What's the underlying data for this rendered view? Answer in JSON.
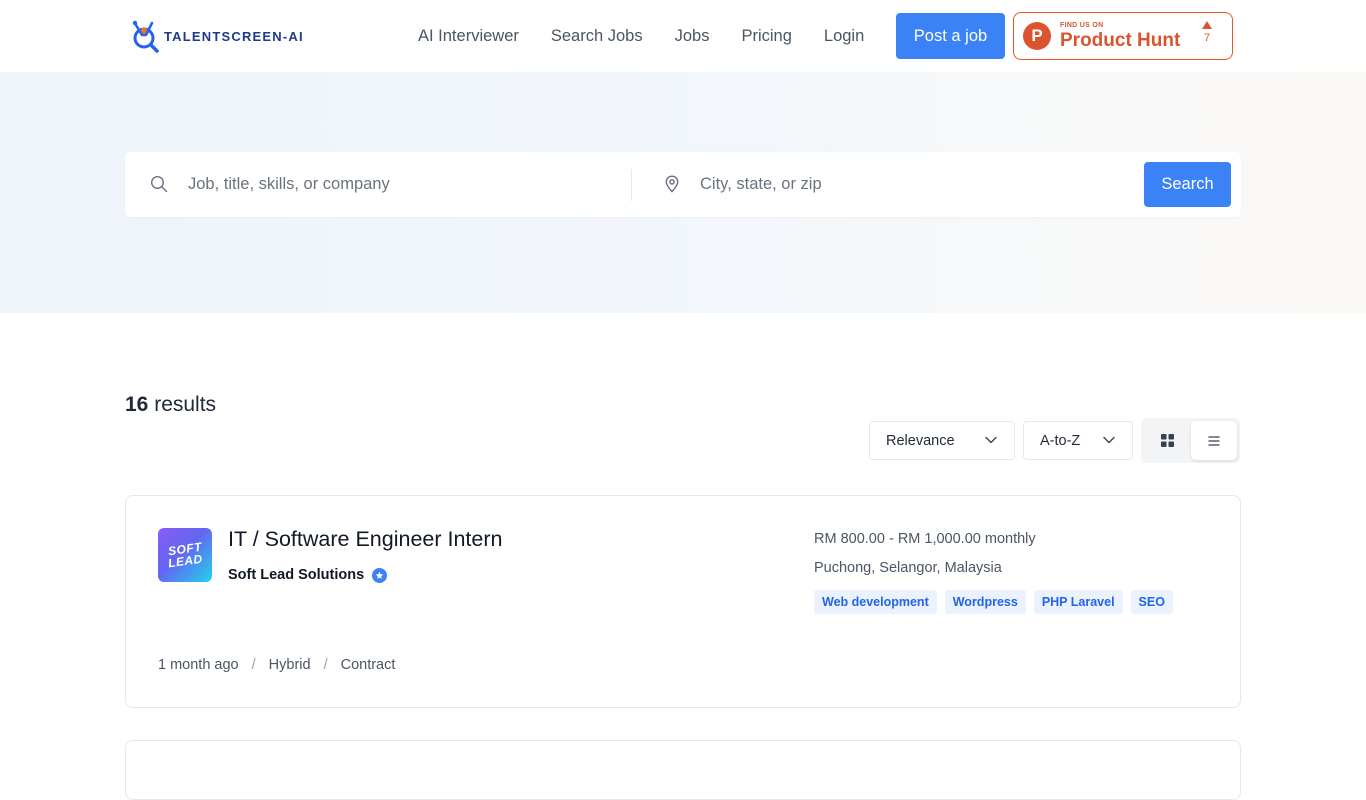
{
  "brand": {
    "name": "TALENTSCREEN",
    "suffix": "-AI"
  },
  "nav": {
    "links": [
      "AI Interviewer",
      "Search Jobs",
      "Jobs",
      "Pricing",
      "Login"
    ],
    "post_job_label": "Post a job"
  },
  "product_hunt": {
    "small": "FIND US ON",
    "big": "Product Hunt",
    "votes": "7",
    "letter": "P"
  },
  "search": {
    "keyword_placeholder": "Job, title, skills, or company",
    "location_placeholder": "City, state, or zip",
    "button_label": "Search"
  },
  "results": {
    "count": "16",
    "label": "results",
    "sort_options": {
      "relevance": "Relevance",
      "order": "A-to-Z"
    },
    "view_mode": "list"
  },
  "jobs": [
    {
      "title": "IT / Software Engineer Intern",
      "company": "Soft Lead Solutions",
      "logo_lines": [
        "SOFT",
        "LEAD"
      ],
      "verified": true,
      "salary": "RM 800.00 - RM 1,000.00 monthly",
      "location": "Puchong, Selangor, Malaysia",
      "tags": [
        "Web development",
        "Wordpress",
        "PHP Laravel",
        "SEO"
      ],
      "posted": "1 month ago",
      "workplace": "Hybrid",
      "type": "Contract"
    }
  ],
  "colors": {
    "accent": "#3b82f6",
    "product_hunt": "#da552f",
    "tag_bg": "#e9f2fd",
    "tag_text": "#2563eb"
  }
}
